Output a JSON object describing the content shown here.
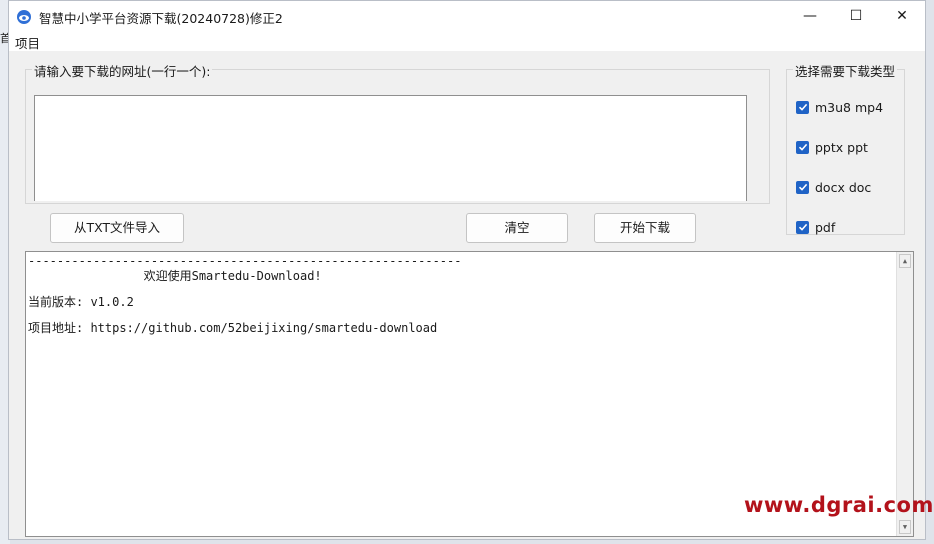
{
  "window": {
    "title": "智慧中小学平台资源下载(20240728)修正2",
    "controls": {
      "minimize": "—",
      "maximize": "☐",
      "close": "✕"
    }
  },
  "menu": {
    "items": [
      {
        "label": "项目"
      }
    ]
  },
  "background_left": {
    "chip1": "首",
    "chip2": ""
  },
  "url_group": {
    "label": "请输入要下载的网址(一行一个):",
    "value": ""
  },
  "buttons": {
    "import": "从TXT文件导入",
    "clear": "清空",
    "start": "开始下载"
  },
  "types_group": {
    "label": "选择需要下载类型",
    "options": [
      {
        "label": "m3u8 mp4",
        "checked": true
      },
      {
        "label": "pptx ppt",
        "checked": true
      },
      {
        "label": "docx doc",
        "checked": true
      },
      {
        "label": "pdf",
        "checked": true
      }
    ]
  },
  "console": {
    "lines": [
      "------------------------------------------------------------",
      "                欢迎使用Smartedu-Download!",
      "当前版本: v1.0.2",
      "项目地址: https://github.com/52beijixing/smartedu-download"
    ]
  },
  "watermark": "www.dgrai.com",
  "colors": {
    "accent": "#1f63c6",
    "watermark": "#b3121b"
  }
}
